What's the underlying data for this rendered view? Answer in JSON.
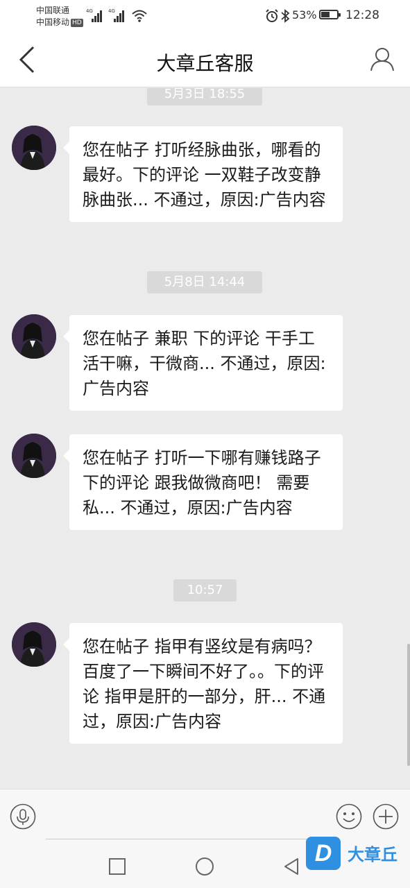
{
  "status_bar": {
    "carrier_1": "中国联通",
    "carrier_2": "中国移动",
    "hd_badge": "HD",
    "network_1": "4G",
    "network_2": "4G",
    "battery_percent": "53%",
    "battery_level": 0.53,
    "time": "12:28"
  },
  "header": {
    "title": "大章丘客服",
    "back_icon": "chevron-left-icon",
    "profile_icon": "person-icon"
  },
  "messages": [
    {
      "timestamp": "5月3日 18:55",
      "text": "您在帖子 打听经脉曲张，哪看的最好。下的评论 一双鞋子改变静脉曲张... 不通过，原因:广告内容"
    },
    {
      "timestamp": "5月8日 14:44",
      "text": "您在帖子 兼职 下的评论 干手工活干嘛，干微商... 不通过，原因:广告内容"
    },
    {
      "text": "您在帖子 打听一下哪有赚钱路子 下的评论 跟我做微商吧！ 需要私... 不通过，原因:广告内容"
    },
    {
      "timestamp": "10:57",
      "text": "您在帖子 指甲有竖纹是有病吗？百度了一下瞬间不好了。。下的评论 指甲是肝的一部分，肝... 不通过，原因:广告内容"
    }
  ],
  "input_bar": {
    "placeholder": "",
    "voice_icon": "microphone-icon",
    "emoji_icon": "smiley-icon",
    "plus_icon": "plus-circle-icon"
  },
  "watermark": {
    "logo_letter": "D",
    "text": "大章丘"
  },
  "colors": {
    "chat_background": "#ebebeb",
    "bubble": "#ffffff",
    "timestamp_pill": "#d9d9d9",
    "watermark_blue": "#2f8fe0"
  }
}
